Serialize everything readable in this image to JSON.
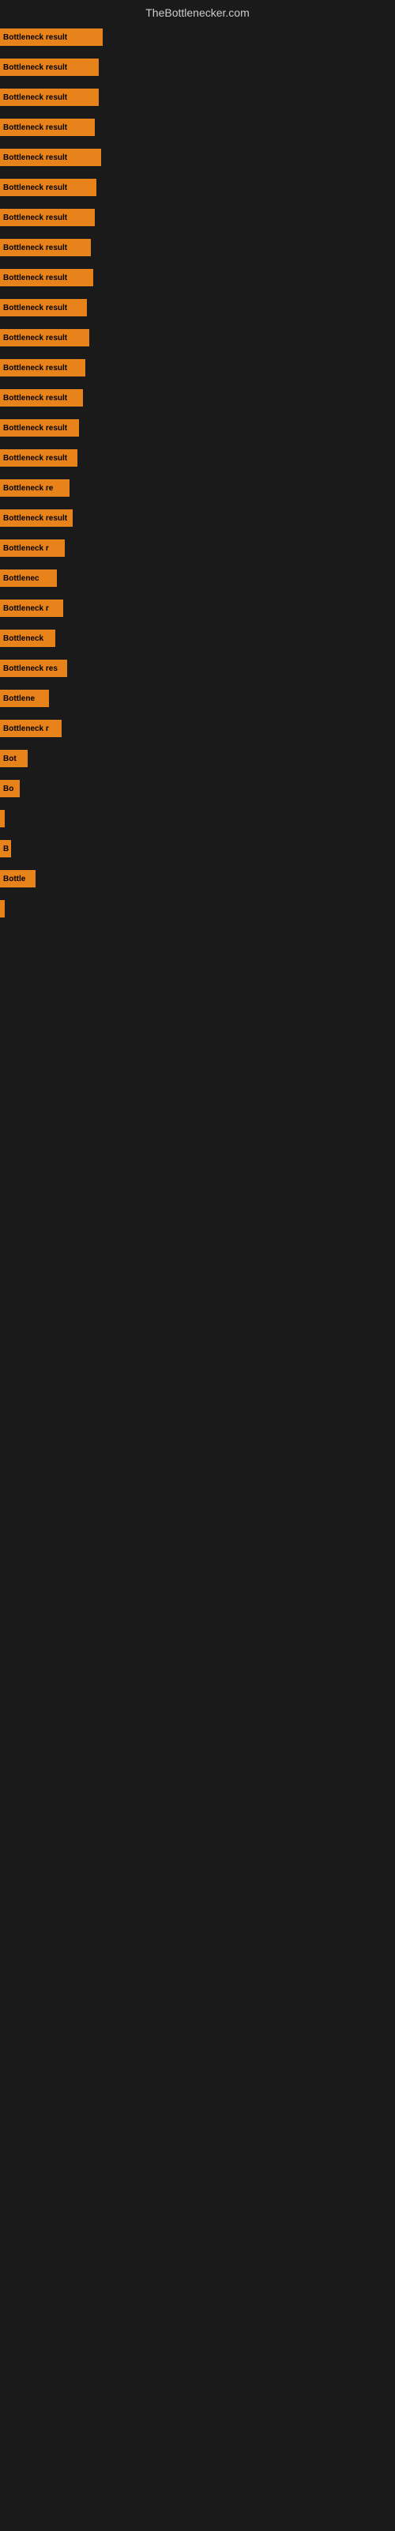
{
  "header": {
    "title": "TheBottlenecker.com"
  },
  "bars": [
    {
      "label": "Bottleneck result",
      "width": 130
    },
    {
      "label": "Bottleneck result",
      "width": 125
    },
    {
      "label": "Bottleneck result",
      "width": 125
    },
    {
      "label": "Bottleneck result",
      "width": 120
    },
    {
      "label": "Bottleneck result",
      "width": 128
    },
    {
      "label": "Bottleneck result",
      "width": 122
    },
    {
      "label": "Bottleneck result",
      "width": 120
    },
    {
      "label": "Bottleneck result",
      "width": 115
    },
    {
      "label": "Bottleneck result",
      "width": 118
    },
    {
      "label": "Bottleneck result",
      "width": 110
    },
    {
      "label": "Bottleneck result",
      "width": 113
    },
    {
      "label": "Bottleneck result",
      "width": 108
    },
    {
      "label": "Bottleneck result",
      "width": 105
    },
    {
      "label": "Bottleneck result",
      "width": 100
    },
    {
      "label": "Bottleneck result",
      "width": 98
    },
    {
      "label": "Bottleneck re",
      "width": 88
    },
    {
      "label": "Bottleneck result",
      "width": 92
    },
    {
      "label": "Bottleneck r",
      "width": 82
    },
    {
      "label": "Bottlenec",
      "width": 72
    },
    {
      "label": "Bottleneck r",
      "width": 80
    },
    {
      "label": "Bottleneck",
      "width": 70
    },
    {
      "label": "Bottleneck res",
      "width": 85
    },
    {
      "label": "Bottlene",
      "width": 62
    },
    {
      "label": "Bottleneck r",
      "width": 78
    },
    {
      "label": "Bot",
      "width": 35
    },
    {
      "label": "Bo",
      "width": 25
    },
    {
      "label": "",
      "width": 6
    },
    {
      "label": "B",
      "width": 14
    },
    {
      "label": "Bottle",
      "width": 45
    },
    {
      "label": "",
      "width": 6
    }
  ]
}
